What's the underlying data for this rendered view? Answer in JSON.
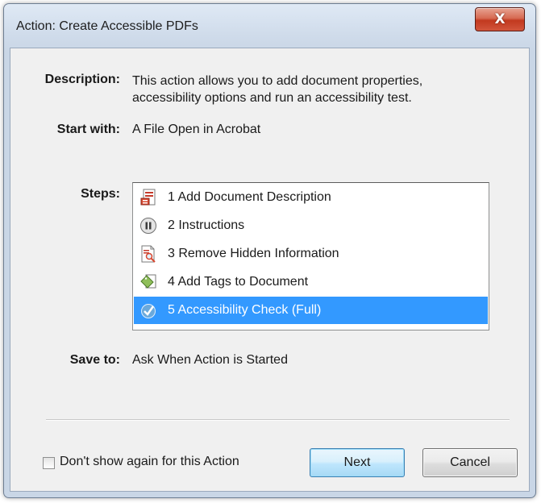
{
  "window": {
    "title": "Action: Create Accessible PDFs",
    "close_glyph": "X"
  },
  "details": {
    "description_label": "Description:",
    "description_line1": "This action allows you to add document properties,",
    "description_line2": "accessibility options and run an accessibility test.",
    "start_label": "Start with:",
    "start_value": "A File Open in Acrobat",
    "steps_label": "Steps:",
    "save_label": "Save to:",
    "save_value": "Ask When Action is Started"
  },
  "steps": [
    {
      "label": "1  Add Document Description",
      "icon": "document-properties-icon",
      "selected": false
    },
    {
      "label": "2  Instructions",
      "icon": "pause-icon",
      "selected": false
    },
    {
      "label": "3  Remove Hidden Information",
      "icon": "search-document-icon",
      "selected": false
    },
    {
      "label": "4  Add Tags to Document",
      "icon": "tag-icon",
      "selected": false
    },
    {
      "label": "5  Accessibility Check (Full)",
      "icon": "accessibility-check-icon",
      "selected": true
    }
  ],
  "footer": {
    "checkbox_label": "Don't show again for this Action",
    "checkbox_checked": false,
    "next_label": "Next",
    "cancel_label": "Cancel"
  },
  "colors": {
    "selection": "#3399ff",
    "close_button": "#c8402a"
  }
}
